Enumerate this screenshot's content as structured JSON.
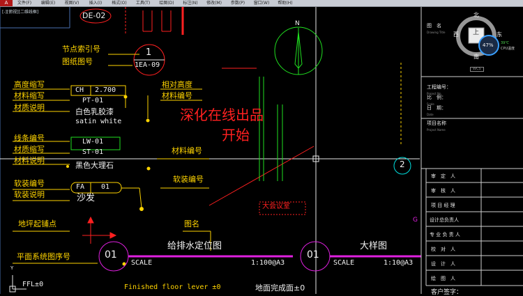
{
  "menubar": {
    "items": [
      "文件(F)",
      "编辑(E)",
      "视图(V)",
      "插入(I)",
      "格式(O)",
      "工具(T)",
      "绘图(D)",
      "标注(N)",
      "修改(M)",
      "参数(P)",
      "窗口(W)",
      "帮助(H)"
    ]
  },
  "viewport_label": "[-][俯视][二维线框]",
  "drawing": {
    "de02": "DE-02",
    "node_index_label": "节点索引号",
    "drawing_no_label": "图纸图号",
    "circle_num": "1",
    "circle_ref": "1EA-09",
    "height_abbr_label": "高度缩写",
    "relative_height_label": "相对高度",
    "material_abbr_label": "材料缩写",
    "material_no_label": "材料编号",
    "material_desc_label": "材质说明",
    "ch_text": "CH",
    "ch_value": "2.700",
    "pt_text": "PT-01",
    "latex_text": "白色乳胶漆",
    "satin_text": "satin white",
    "line_no_label": "线条编号",
    "texture_abbr_label": "材质缩写",
    "material_desc2_label": "材料说明",
    "lw_text": "LW-01",
    "st_text": "ST-01",
    "marble_text": "黑色大理石",
    "material_no2_label": "材料编号",
    "soft_no_label": "软装编号",
    "soft_desc_label": "软装说明",
    "fa_text": "FA",
    "fa_num": "01",
    "sofa_text": "沙发",
    "soft_no2_label": "软装编号",
    "floor_start_label": "地坪起铺点",
    "drawing_name_label": "图名",
    "plan_seq_label": "平面系统图序号",
    "red_title_1": "深化在线出品",
    "red_title_2": "开始",
    "big_meeting_room": "大会议室",
    "north": "N",
    "axis_num": "2",
    "left_title_num": "01",
    "left_title_name": "给排水定位图",
    "left_scale": "SCALE",
    "left_ratio": "1:100@A3",
    "right_title_num": "01",
    "right_title_name": "大样图",
    "right_scale": "SCALE",
    "right_ratio": "1:10@A3",
    "ffl_text": "FFL±0",
    "finished_floor_text": "Finished floor lever ±0",
    "floor_done_text": "地面完成面±0",
    "ucs_y": "Y",
    "g_mark": "G"
  },
  "viewcube": {
    "north": "北",
    "west": "西",
    "east": "东",
    "south": "南",
    "face": "上",
    "wcs": "WCS",
    "percent": "47%",
    "temp": "39℃",
    "cpu": "CPU温度"
  },
  "title_block": {
    "figure_name": "图　名",
    "figure_name_en": "Drawing Title",
    "project_no": "工程编号：",
    "project_no_en": "Project No.",
    "scale": "比　例：",
    "scale_en": "Scale",
    "date": "日　期：",
    "date_en": "Date",
    "project_name": "项目名称",
    "project_name_en": "Project Name",
    "signoffs": [
      "审　定　人",
      "审　核　人",
      "项 目 经 理",
      "设计总负责人",
      "专 业 负 责 人",
      "校　对　人",
      "设　计　人",
      "绘　图　人"
    ],
    "client_sign": "客户签字："
  },
  "colors": {
    "yellow": "#ffd400",
    "red": "#ff2020",
    "magenta": "#e020e0",
    "green": "#20e020",
    "cyan": "#00e0e0"
  }
}
